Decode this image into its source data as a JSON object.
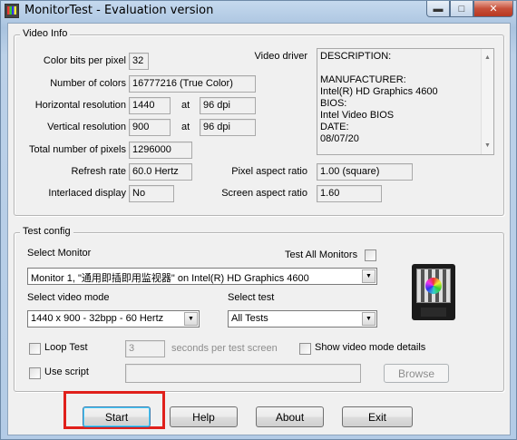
{
  "window": {
    "title": "MonitorTest - Evaluation version"
  },
  "video_info": {
    "title": "Video Info",
    "color_bits_label": "Color bits per pixel",
    "color_bits_value": "32",
    "num_colors_label": "Number of colors",
    "num_colors_value": "16777216 (True Color)",
    "horiz_res_label": "Horizontal resolution",
    "horiz_res_value": "1440",
    "horiz_dpi_value": "96 dpi",
    "vert_res_label": "Vertical resolution",
    "vert_res_value": "900",
    "vert_dpi_value": "96 dpi",
    "at_label": "at",
    "total_pixels_label": "Total number of pixels",
    "total_pixels_value": "1296000",
    "refresh_label": "Refresh rate",
    "refresh_value": "60.0 Hertz",
    "interlaced_label": "Interlaced display",
    "interlaced_value": "No",
    "video_driver_label": "Video driver",
    "driver_lines": [
      "DESCRIPTION:",
      "",
      "MANUFACTURER:",
      "Intel(R) HD Graphics 4600",
      "BIOS:",
      "Intel Video BIOS",
      "DATE:",
      "08/07/20"
    ],
    "pixel_aspect_label": "Pixel aspect ratio",
    "pixel_aspect_value": "1.00 (square)",
    "screen_aspect_label": "Screen aspect ratio",
    "screen_aspect_value": "1.60"
  },
  "test_config": {
    "title": "Test config",
    "select_monitor_label": "Select Monitor",
    "monitor_value": "Monitor 1, \"通用即插即用监视器\" on Intel(R) HD Graphics 4600",
    "test_all_label": "Test All Monitors",
    "select_mode_label": "Select video mode",
    "mode_value": "1440 x 900 - 32bpp - 60 Hertz",
    "select_test_label": "Select test",
    "test_value": "All Tests",
    "loop_test_label": "Loop Test",
    "seconds_value": "3",
    "seconds_label": "seconds per test screen",
    "show_details_label": "Show video mode details",
    "use_script_label": "Use script",
    "script_value": "",
    "browse_label": "Browse"
  },
  "buttons": {
    "start": "Start",
    "help": "Help",
    "about": "About",
    "exit": "Exit"
  },
  "icons": {
    "minimize": "minimize-icon",
    "maximize": "maximize-icon",
    "close": "close-icon",
    "monitor": "monitor-test-pattern-icon"
  }
}
